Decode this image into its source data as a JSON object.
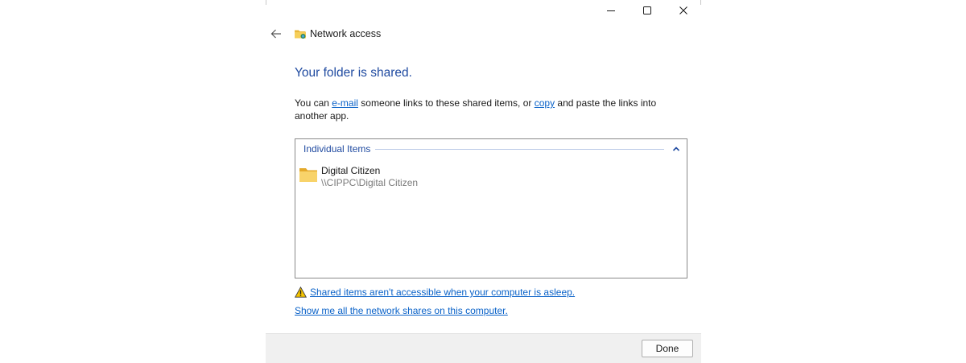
{
  "window": {
    "title": "Network access",
    "controls": {
      "minimize_icon": "minimize-icon",
      "maximize_icon": "maximize-icon",
      "close_icon": "close-icon"
    }
  },
  "main": {
    "heading": "Your folder is shared.",
    "description": {
      "part1": "You can ",
      "email_link": "e-mail",
      "part2": " someone links to these shared items, or ",
      "copy_link": "copy",
      "part3": " and paste the links into another app."
    },
    "group": {
      "label": "Individual Items",
      "items": [
        {
          "name": "Digital Citizen",
          "path": "\\\\CIPPC\\Digital Citizen"
        }
      ]
    },
    "warning_link": "Shared items aren't accessible when your computer is asleep.",
    "shares_link": "Show me all the network shares on this computer."
  },
  "footer": {
    "done_label": "Done"
  },
  "colors": {
    "heading": "#1f4aa0",
    "link": "#0a62c8",
    "footer_bg": "#f0f0f0"
  }
}
